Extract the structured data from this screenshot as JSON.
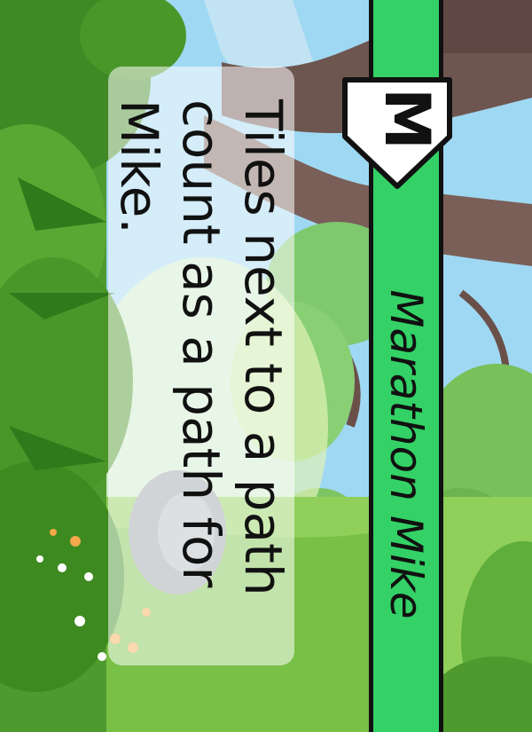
{
  "card": {
    "character_name": "Marathon Mike",
    "badge_letter": "M",
    "ability_text": "Tiles next to a path count as a path for Mike.",
    "colors": {
      "banner": "#33d166",
      "banner_border": "#111111",
      "panel": "rgba(255,255,255,0.55)",
      "text": "#111111"
    },
    "background_scene": "jungle-illustration"
  }
}
